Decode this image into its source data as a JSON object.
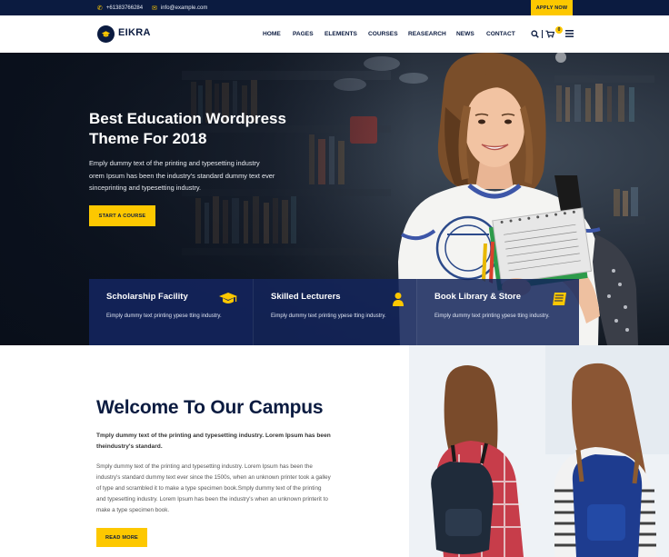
{
  "topbar": {
    "phone": "+61383766284",
    "email": "info@example.com",
    "apply_label": "APPLY NOW"
  },
  "brand": {
    "name": "EIKRA"
  },
  "nav": {
    "items": [
      "HOME",
      "PAGES",
      "ELEMENTS",
      "COURSES",
      "REASEARCH",
      "NEWS",
      "CONTACT"
    ],
    "cart_count": "0"
  },
  "hero": {
    "title_line1": "Best Education Wordpress",
    "title_line2": "Theme For 2018",
    "text_line1": "Emply dummy text of the printing and typesetting industry",
    "text_line2": "orem Ipsum has been the industry's standard dummy text ever",
    "text_line3": "sinceprinting and typesetting industry.",
    "cta_label": "START A COURSE"
  },
  "features": [
    {
      "title": "Scholarship Facility",
      "text": "Eimply dummy text printing ypese tting industry.",
      "icon": "graduation-cap-icon"
    },
    {
      "title": "Skilled Lecturers",
      "text": "Eimply dummy text printing ypese tting industry.",
      "icon": "user-icon"
    },
    {
      "title": "Book Library & Store",
      "text": "Eimply dummy text printing ypese tting industry.",
      "icon": "book-icon"
    }
  ],
  "welcome": {
    "title": "Welcome To Our Campus",
    "lead": "Tmply dummy text of the printing and typesetting industry. Lorem Ipsum has been theindustry's standard.",
    "body": "Smply dummy text of the printing and typesetting industry. Lorem Ipsum has been the industry's standard dummy text ever since the 1500s, when an unknown printer took a galley of type and scrambled it to make a type specimen book.Smply dummy text of the printing and typesetting industry. Lorem Ipsum has been the industry's when an unknown printerit to make a type specimen book.",
    "read_more_label": "READ MORE"
  },
  "colors": {
    "navy": "#0b1b40",
    "accent_yellow": "#fdc800",
    "feature_blue": "#13245a"
  }
}
